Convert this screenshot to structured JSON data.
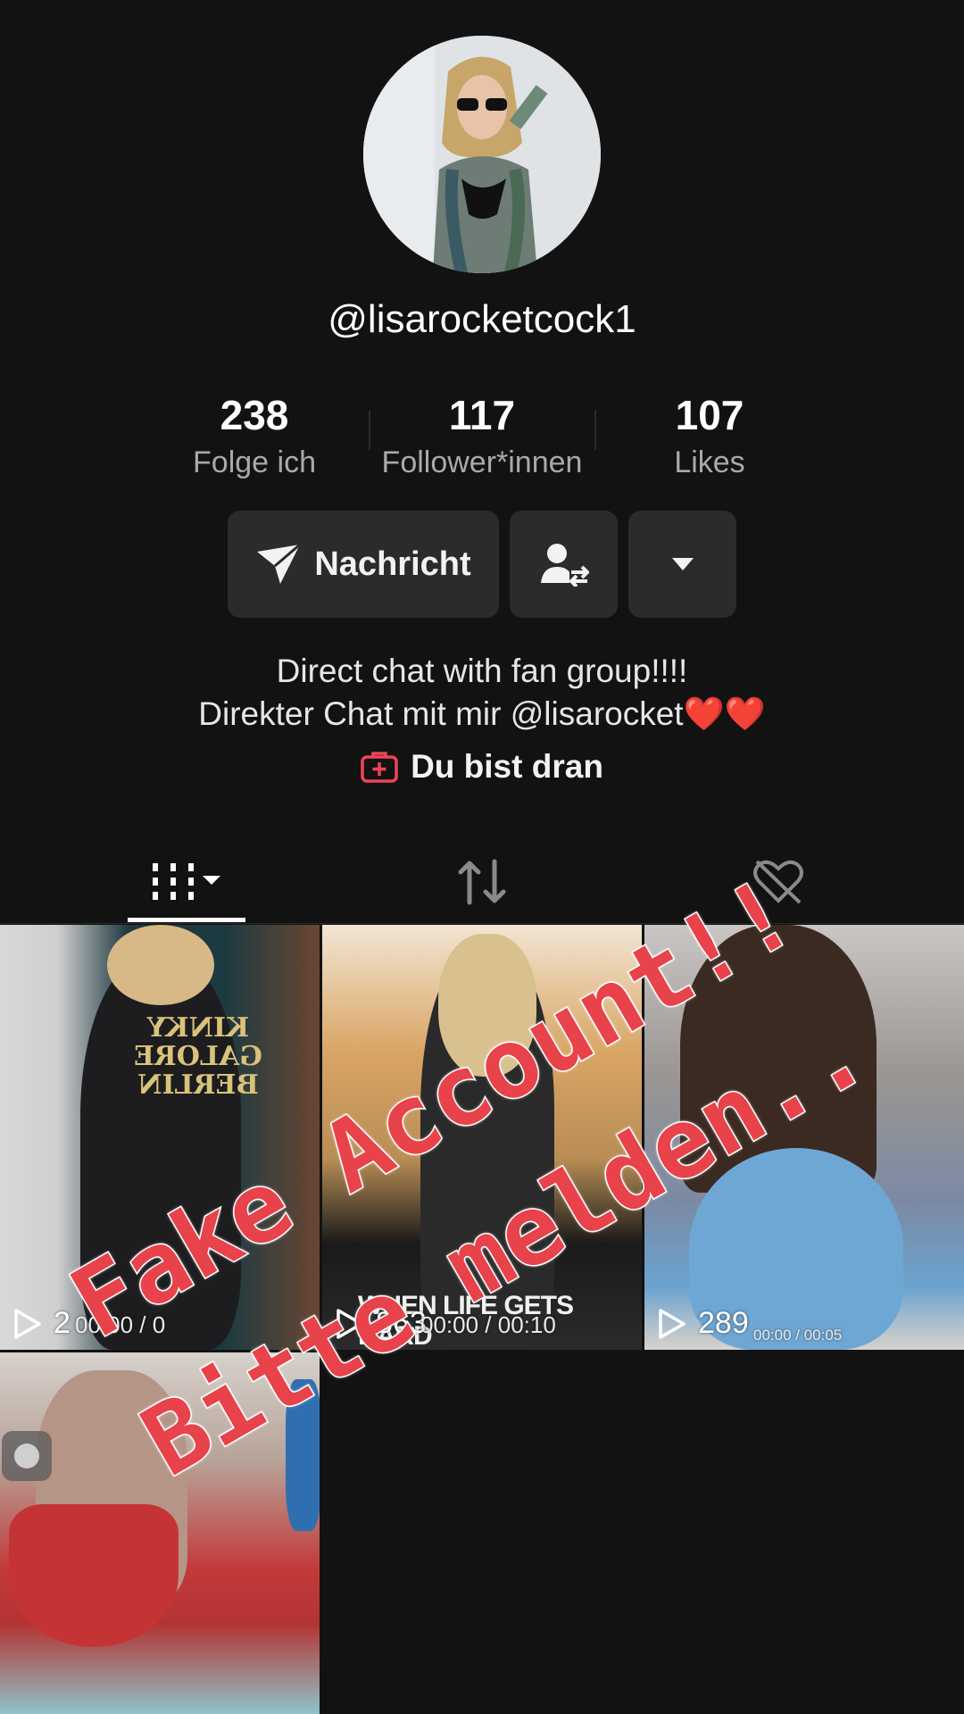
{
  "profile": {
    "username": "@lisarocketcock1",
    "stats": [
      {
        "value": "238",
        "label": "Folge ich"
      },
      {
        "value": "117",
        "label": "Follower*innen"
      },
      {
        "value": "107",
        "label": "Likes"
      }
    ]
  },
  "actions": {
    "message_label": "Nachricht"
  },
  "bio": {
    "line1": "Direct chat with fan group!!!!",
    "line2": "Direkter Chat mit mir @lisarocket❤️❤️",
    "turn_label": "Du bist dran"
  },
  "videos": [
    {
      "views": "2",
      "time": "00:00 / 0",
      "hoodie": "KINKY\nGALORE\nBERLIN"
    },
    {
      "views": "863",
      "time": "00:00 / 00:10",
      "caption": "WHEN LIFE GETS HARD"
    },
    {
      "views": "289",
      "time": "00:00 / 00:05"
    },
    {}
  ],
  "overlay": {
    "line1": "Fake Account!!",
    "line2": "Bitte melden.."
  },
  "colors": {
    "background": "#121212",
    "button": "#2b2b2b",
    "accent": "#e8424a"
  }
}
